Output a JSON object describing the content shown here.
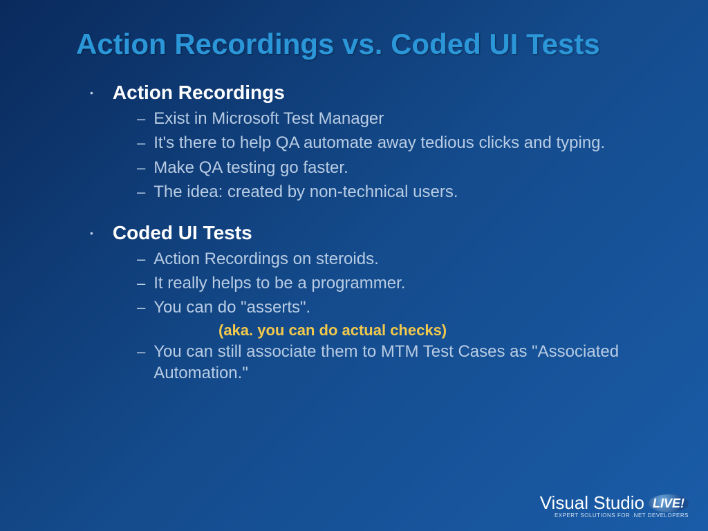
{
  "title": "Action Recordings vs. Coded UI Tests",
  "sections": [
    {
      "heading": "Action Recordings",
      "items": [
        "Exist in Microsoft Test Manager",
        "It's there to help QA automate away tedious clicks and typing.",
        "Make QA testing go faster.",
        "The idea: created by non-technical users."
      ]
    },
    {
      "heading": "Coded UI Tests",
      "items": [
        "Action Recordings on steroids.",
        "It really helps to be a programmer.",
        "You can do \"asserts\".",
        "You can still associate them to MTM Test Cases as \"Associated Automation.\""
      ],
      "aside_after_index": 2,
      "aside": "(aka. you can do actual checks)"
    }
  ],
  "footer": {
    "brand": "Visual Studio",
    "live": "LIVE!",
    "tag": "EXPERT SOLUTIONS FOR .NET DEVELOPERS"
  }
}
